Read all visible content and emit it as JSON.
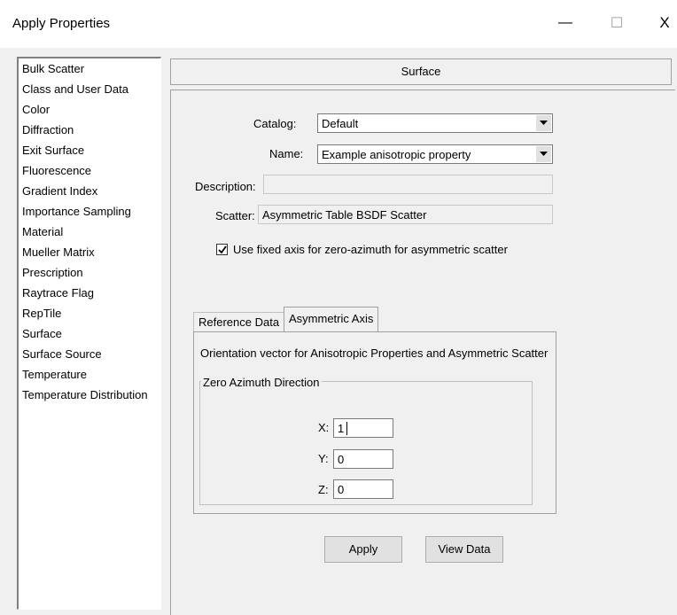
{
  "window": {
    "title": "Apply Properties",
    "minimize": "—",
    "maximize": "☐",
    "close": "X"
  },
  "sidebar": {
    "items": [
      "Bulk Scatter",
      "Class and User Data",
      "Color",
      "Diffraction",
      "Exit Surface",
      "Fluorescence",
      "Gradient Index",
      "Importance Sampling",
      "Material",
      "Mueller Matrix",
      "Prescription",
      "Raytrace Flag",
      "RepTile",
      "Surface",
      "Surface Source",
      "Temperature",
      "Temperature Distribution"
    ],
    "selected": "Surface"
  },
  "header": {
    "title": "Surface"
  },
  "form": {
    "catalog_label": "Catalog:",
    "catalog_value": "Default",
    "name_label": "Name:",
    "name_value": "Example anisotropic property",
    "description_label": "Description:",
    "description_value": "",
    "scatter_label": "Scatter:",
    "scatter_value": "Asymmetric Table BSDF Scatter",
    "fixed_axis_label": "Use fixed axis for zero-azimuth for asymmetric scatter",
    "fixed_axis_checked": true
  },
  "tabs": [
    {
      "label": "Reference Data",
      "active": false
    },
    {
      "label": "Asymmetric Axis",
      "active": true
    }
  ],
  "axis_panel": {
    "description": "Orientation vector for Anisotropic Properties and Asymmetric Scatter",
    "group_label": "Zero Azimuth Direction",
    "x_label": "X:",
    "x_value": "1",
    "y_label": "Y:",
    "y_value": "0",
    "z_label": "Z:",
    "z_value": "0"
  },
  "buttons": {
    "apply": "Apply",
    "view_data": "View Data"
  },
  "icons": {
    "dropdown": "chevron-down-icon",
    "check": "check-icon"
  }
}
